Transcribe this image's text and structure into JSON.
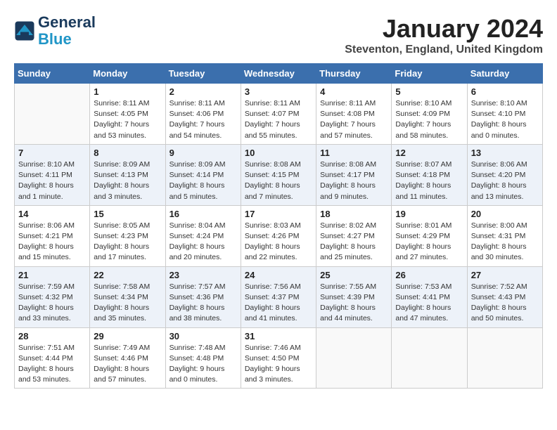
{
  "header": {
    "logo_line1": "General",
    "logo_line2": "Blue",
    "month": "January 2024",
    "location": "Steventon, England, United Kingdom"
  },
  "days_of_week": [
    "Sunday",
    "Monday",
    "Tuesday",
    "Wednesday",
    "Thursday",
    "Friday",
    "Saturday"
  ],
  "weeks": [
    [
      {
        "day": "",
        "info": ""
      },
      {
        "day": "1",
        "info": "Sunrise: 8:11 AM\nSunset: 4:05 PM\nDaylight: 7 hours\nand 53 minutes."
      },
      {
        "day": "2",
        "info": "Sunrise: 8:11 AM\nSunset: 4:06 PM\nDaylight: 7 hours\nand 54 minutes."
      },
      {
        "day": "3",
        "info": "Sunrise: 8:11 AM\nSunset: 4:07 PM\nDaylight: 7 hours\nand 55 minutes."
      },
      {
        "day": "4",
        "info": "Sunrise: 8:11 AM\nSunset: 4:08 PM\nDaylight: 7 hours\nand 57 minutes."
      },
      {
        "day": "5",
        "info": "Sunrise: 8:10 AM\nSunset: 4:09 PM\nDaylight: 7 hours\nand 58 minutes."
      },
      {
        "day": "6",
        "info": "Sunrise: 8:10 AM\nSunset: 4:10 PM\nDaylight: 8 hours\nand 0 minutes."
      }
    ],
    [
      {
        "day": "7",
        "info": "Sunrise: 8:10 AM\nSunset: 4:11 PM\nDaylight: 8 hours\nand 1 minute."
      },
      {
        "day": "8",
        "info": "Sunrise: 8:09 AM\nSunset: 4:13 PM\nDaylight: 8 hours\nand 3 minutes."
      },
      {
        "day": "9",
        "info": "Sunrise: 8:09 AM\nSunset: 4:14 PM\nDaylight: 8 hours\nand 5 minutes."
      },
      {
        "day": "10",
        "info": "Sunrise: 8:08 AM\nSunset: 4:15 PM\nDaylight: 8 hours\nand 7 minutes."
      },
      {
        "day": "11",
        "info": "Sunrise: 8:08 AM\nSunset: 4:17 PM\nDaylight: 8 hours\nand 9 minutes."
      },
      {
        "day": "12",
        "info": "Sunrise: 8:07 AM\nSunset: 4:18 PM\nDaylight: 8 hours\nand 11 minutes."
      },
      {
        "day": "13",
        "info": "Sunrise: 8:06 AM\nSunset: 4:20 PM\nDaylight: 8 hours\nand 13 minutes."
      }
    ],
    [
      {
        "day": "14",
        "info": "Sunrise: 8:06 AM\nSunset: 4:21 PM\nDaylight: 8 hours\nand 15 minutes."
      },
      {
        "day": "15",
        "info": "Sunrise: 8:05 AM\nSunset: 4:23 PM\nDaylight: 8 hours\nand 17 minutes."
      },
      {
        "day": "16",
        "info": "Sunrise: 8:04 AM\nSunset: 4:24 PM\nDaylight: 8 hours\nand 20 minutes."
      },
      {
        "day": "17",
        "info": "Sunrise: 8:03 AM\nSunset: 4:26 PM\nDaylight: 8 hours\nand 22 minutes."
      },
      {
        "day": "18",
        "info": "Sunrise: 8:02 AM\nSunset: 4:27 PM\nDaylight: 8 hours\nand 25 minutes."
      },
      {
        "day": "19",
        "info": "Sunrise: 8:01 AM\nSunset: 4:29 PM\nDaylight: 8 hours\nand 27 minutes."
      },
      {
        "day": "20",
        "info": "Sunrise: 8:00 AM\nSunset: 4:31 PM\nDaylight: 8 hours\nand 30 minutes."
      }
    ],
    [
      {
        "day": "21",
        "info": "Sunrise: 7:59 AM\nSunset: 4:32 PM\nDaylight: 8 hours\nand 33 minutes."
      },
      {
        "day": "22",
        "info": "Sunrise: 7:58 AM\nSunset: 4:34 PM\nDaylight: 8 hours\nand 35 minutes."
      },
      {
        "day": "23",
        "info": "Sunrise: 7:57 AM\nSunset: 4:36 PM\nDaylight: 8 hours\nand 38 minutes."
      },
      {
        "day": "24",
        "info": "Sunrise: 7:56 AM\nSunset: 4:37 PM\nDaylight: 8 hours\nand 41 minutes."
      },
      {
        "day": "25",
        "info": "Sunrise: 7:55 AM\nSunset: 4:39 PM\nDaylight: 8 hours\nand 44 minutes."
      },
      {
        "day": "26",
        "info": "Sunrise: 7:53 AM\nSunset: 4:41 PM\nDaylight: 8 hours\nand 47 minutes."
      },
      {
        "day": "27",
        "info": "Sunrise: 7:52 AM\nSunset: 4:43 PM\nDaylight: 8 hours\nand 50 minutes."
      }
    ],
    [
      {
        "day": "28",
        "info": "Sunrise: 7:51 AM\nSunset: 4:44 PM\nDaylight: 8 hours\nand 53 minutes."
      },
      {
        "day": "29",
        "info": "Sunrise: 7:49 AM\nSunset: 4:46 PM\nDaylight: 8 hours\nand 57 minutes."
      },
      {
        "day": "30",
        "info": "Sunrise: 7:48 AM\nSunset: 4:48 PM\nDaylight: 9 hours\nand 0 minutes."
      },
      {
        "day": "31",
        "info": "Sunrise: 7:46 AM\nSunset: 4:50 PM\nDaylight: 9 hours\nand 3 minutes."
      },
      {
        "day": "",
        "info": ""
      },
      {
        "day": "",
        "info": ""
      },
      {
        "day": "",
        "info": ""
      }
    ]
  ]
}
